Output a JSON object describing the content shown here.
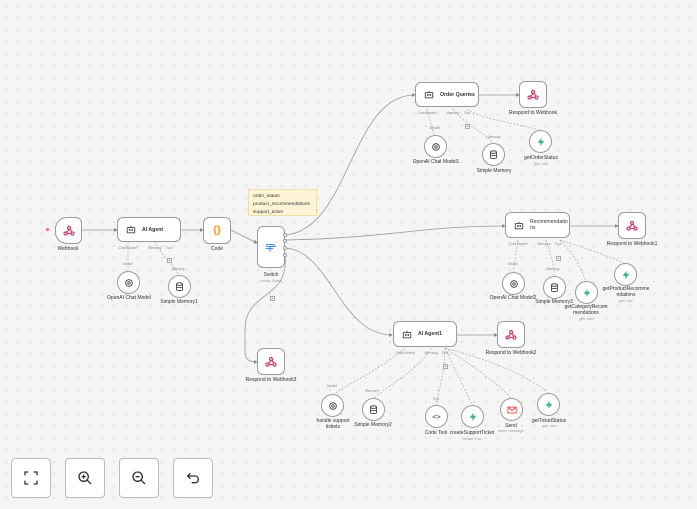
{
  "note": {
    "lines": [
      "order_status",
      "product_recommendations",
      "support_ticket"
    ]
  },
  "nodes": {
    "webhook": {
      "label": "Webhook"
    },
    "ai_agent": {
      "title": "AI Agent",
      "ports": [
        "Chat Model*",
        "Memory",
        "Tool"
      ]
    },
    "code": {
      "label": "Code"
    },
    "switch": {
      "label": "Switch",
      "sub": "mode: Rules"
    },
    "respond3": {
      "label": "Respond to Webhook3"
    },
    "openai_model": {
      "label": "OpenAI Chat Model"
    },
    "simple_memory1": {
      "label": "Simple Memory1"
    },
    "order_queries": {
      "title": "Order Queries",
      "ports": [
        "Chat Model*",
        "Memory",
        "Tool"
      ]
    },
    "respond": {
      "label": "Respond to Webhook"
    },
    "openai_model1": {
      "label": "OpenAI Chat Model1"
    },
    "simple_memory": {
      "label": "Simple Memory"
    },
    "get_order_status": {
      "label": "getOrderStatus",
      "sub": "get: row"
    },
    "recommendations": {
      "title": "Recommendatio\nns",
      "ports": [
        "Chat Model*",
        "Memory",
        "Tool"
      ]
    },
    "respond1": {
      "label": "Respond to Webhook1"
    },
    "openai_model2": {
      "label": "OpenAI Chat Model2"
    },
    "simple_memory3": {
      "label": "Simple Memory3"
    },
    "get_category": {
      "label": "getCategoryRecom\nmendations",
      "sub": "get: row"
    },
    "get_product": {
      "label": "getProductRecomme\nndations",
      "sub": "get: row"
    },
    "ai_agent1": {
      "title": "AI Agent1",
      "ports": [
        "Chat Model*",
        "Memory",
        "Tool"
      ]
    },
    "respond2": {
      "label": "Respond to Webhook2"
    },
    "handle_support": {
      "label": "handle support\ntickets"
    },
    "simple_memory2": {
      "label": "Simple Memory2"
    },
    "code_tool": {
      "label": "Code Tool"
    },
    "create_ticket": {
      "label": "createSupportTicket",
      "sub": "create: row"
    },
    "send": {
      "label": "Send",
      "sub": "send: message"
    },
    "get_ticket": {
      "label": "getTicketStatus",
      "sub": "get: row"
    }
  },
  "edge_labels": {
    "model": "Model",
    "memory": "Memory",
    "tool": "Tool"
  },
  "controls": {
    "fit": "fit-view",
    "zoom_in": "zoom-in",
    "zoom_out": "zoom-out",
    "undo": "undo"
  },
  "colors": {
    "accent": "#ff6d5a",
    "tool_green": "#35b57f",
    "code_orange": "#f79009",
    "switch_blue": "#3b8ef0",
    "note_bg": "#fff5d6"
  }
}
